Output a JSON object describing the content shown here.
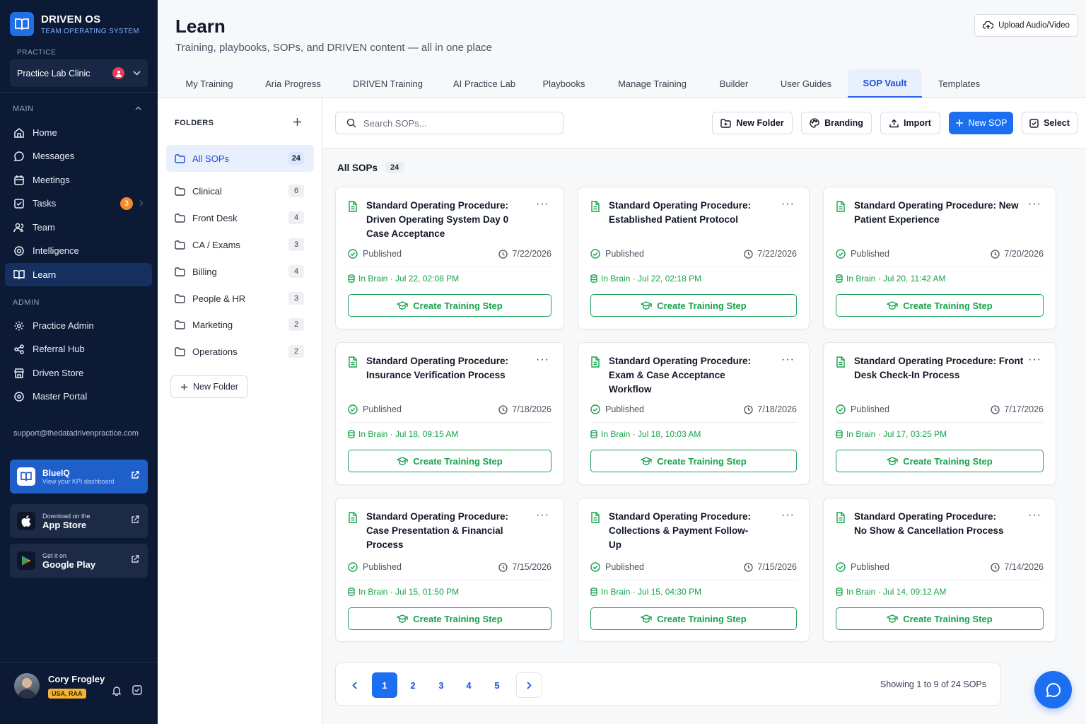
{
  "brand": {
    "name": "DRIVEN OS",
    "subtitle": "TEAM OPERATING SYSTEM"
  },
  "practice": {
    "label": "PRACTICE",
    "name": "Practice Lab Clinic",
    "badge_count": "2"
  },
  "sidebar": {
    "main_label": "MAIN",
    "main_items": [
      {
        "label": "Home",
        "icon": "home-icon"
      },
      {
        "label": "Messages",
        "icon": "message-icon"
      },
      {
        "label": "Meetings",
        "icon": "calendar-icon"
      },
      {
        "label": "Tasks",
        "icon": "checkbox-icon",
        "count": "3"
      },
      {
        "label": "Team",
        "icon": "users-icon"
      },
      {
        "label": "Intelligence",
        "icon": "brain-icon"
      },
      {
        "label": "Learn",
        "icon": "book-icon",
        "active": true
      }
    ],
    "admin_label": "ADMIN",
    "admin_items": [
      {
        "label": "Practice Admin",
        "icon": "gear-icon"
      },
      {
        "label": "Referral Hub",
        "icon": "share-icon"
      },
      {
        "label": "Driven Store",
        "icon": "store-icon"
      },
      {
        "label": "Master Portal",
        "icon": "portal-icon"
      }
    ],
    "support_email": "support@thedatadrivenpractice.com",
    "promos": {
      "blueiq": {
        "title": "BlueIQ",
        "subtitle": "View your KPI dashboard"
      },
      "appstore": {
        "small": "Download on the",
        "big": "App Store"
      },
      "googleplay": {
        "small": "Get it on",
        "big": "Google Play"
      }
    },
    "user": {
      "name": "Cory Frogley",
      "badge": "USA, RAA"
    }
  },
  "header": {
    "title": "Learn",
    "subtitle": "Training, playbooks, SOPs, and DRIVEN content — all in one place",
    "upload_label": "Upload Audio/Video"
  },
  "tabs": [
    "My Training",
    "Aria Progress",
    "DRIVEN Training",
    "AI Practice Lab",
    "Playbooks",
    "Manage Training",
    "Builder",
    "User Guides",
    "SOP Vault",
    "Templates"
  ],
  "active_tab": "SOP Vault",
  "folders": {
    "title": "FOLDERS",
    "items": [
      {
        "name": "All SOPs",
        "count": "24"
      },
      {
        "name": "Clinical",
        "count": "6"
      },
      {
        "name": "Front Desk",
        "count": "4"
      },
      {
        "name": "CA / Exams",
        "count": "3"
      },
      {
        "name": "Billing",
        "count": "4"
      },
      {
        "name": "People & HR",
        "count": "3"
      },
      {
        "name": "Marketing",
        "count": "2"
      },
      {
        "name": "Operations",
        "count": "2"
      }
    ],
    "new_folder_label": "New Folder"
  },
  "toolbar": {
    "search_placeholder": "Search SOPs...",
    "new_folder": "New Folder",
    "branding": "Branding",
    "import": "Import",
    "new_sop": "New SOP",
    "select": "Select"
  },
  "section": {
    "title": "All SOPs",
    "count": "24"
  },
  "cards": [
    {
      "title": "Standard Operating Procedure: Driven Operating System Day 0 Case Acceptance",
      "status": "Published",
      "date": "7/22/2026",
      "brain": "In Brain · Jul 22, 02:08 PM",
      "action": "Create Training Step"
    },
    {
      "title": "Standard Operating Procedure: Established Patient Protocol",
      "status": "Published",
      "date": "7/22/2026",
      "brain": "In Brain · Jul 22, 02:18 PM",
      "action": "Create Training Step"
    },
    {
      "title": "Standard Operating Procedure: New Patient Experience",
      "status": "Published",
      "date": "7/20/2026",
      "brain": "In Brain · Jul 20, 11:42 AM",
      "action": "Create Training Step"
    },
    {
      "title": "Standard Operating Procedure: Insurance Verification Process",
      "status": "Published",
      "date": "7/18/2026",
      "brain": "In Brain · Jul 18, 09:15 AM",
      "action": "Create Training Step"
    },
    {
      "title": "Standard Operating Procedure: Exam & Case Acceptance Workflow",
      "status": "Published",
      "date": "7/18/2026",
      "brain": "In Brain · Jul 18, 10:03 AM",
      "action": "Create Training Step"
    },
    {
      "title": "Standard Operating Procedure: Front Desk Check-In Process",
      "status": "Published",
      "date": "7/17/2026",
      "brain": "In Brain · Jul 17, 03:25 PM",
      "action": "Create Training Step"
    },
    {
      "title": "Standard Operating Procedure: Case Presentation & Financial Process",
      "status": "Published",
      "date": "7/15/2026",
      "brain": "In Brain · Jul 15, 01:50 PM",
      "action": "Create Training Step"
    },
    {
      "title": "Standard Operating Procedure: Collections & Payment Follow-Up",
      "status": "Published",
      "date": "7/15/2026",
      "brain": "In Brain · Jul 15, 04:30 PM",
      "action": "Create Training Step"
    },
    {
      "title": "Standard Operating Procedure: No Show & Cancellation Process",
      "status": "Published",
      "date": "7/14/2026",
      "brain": "In Brain · Jul 14, 09:12 AM",
      "action": "Create Training Step"
    }
  ],
  "pagination": {
    "pages": [
      "1",
      "2",
      "3",
      "4",
      "5"
    ],
    "current": "1",
    "showing": "Showing 1 to 9 of 24 SOPs"
  },
  "colors": {
    "sidebar_bg": "#0c1a35",
    "accent": "#1d6ff2",
    "success": "#16a34a",
    "tasks_badge": "#f28c28"
  }
}
